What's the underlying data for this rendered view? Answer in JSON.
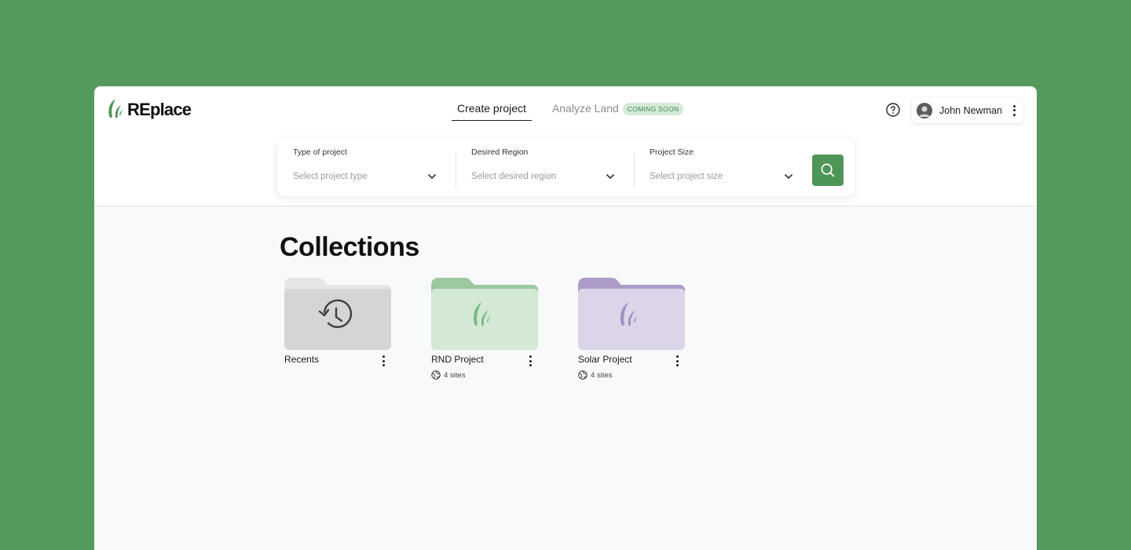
{
  "app": {
    "logo_text": "REplace"
  },
  "nav": {
    "tabs": [
      {
        "label": "Create project",
        "active": true
      },
      {
        "label": "Analyze Land",
        "active": false,
        "badge": "COMING SOON"
      }
    ]
  },
  "user": {
    "name": "John Newman"
  },
  "search": {
    "fields": [
      {
        "label": "Type of project",
        "placeholder": "Select project type"
      },
      {
        "label": "Desired Region",
        "placeholder": "Select desired region"
      },
      {
        "label": "Project Size",
        "placeholder": "Select project size"
      }
    ]
  },
  "collections": {
    "title": "Collections",
    "items": [
      {
        "name": "Recents",
        "icon": "history-icon",
        "color": "#d5d5d5",
        "tab_color": "#e6e6e6"
      },
      {
        "name": "RND Project",
        "sites": "4 sites",
        "icon": "leaf-logo-icon",
        "color": "#d4e8d6",
        "tab_color": "#9cc99f"
      },
      {
        "name": "Solar Project",
        "sites": "4 sites",
        "icon": "leaf-logo-icon",
        "color": "#dcd5e9",
        "tab_color": "#ab9cc8"
      }
    ]
  },
  "colors": {
    "background": "#559a5d",
    "accent": "#4e9658",
    "badge_bg": "#d4ead7"
  }
}
